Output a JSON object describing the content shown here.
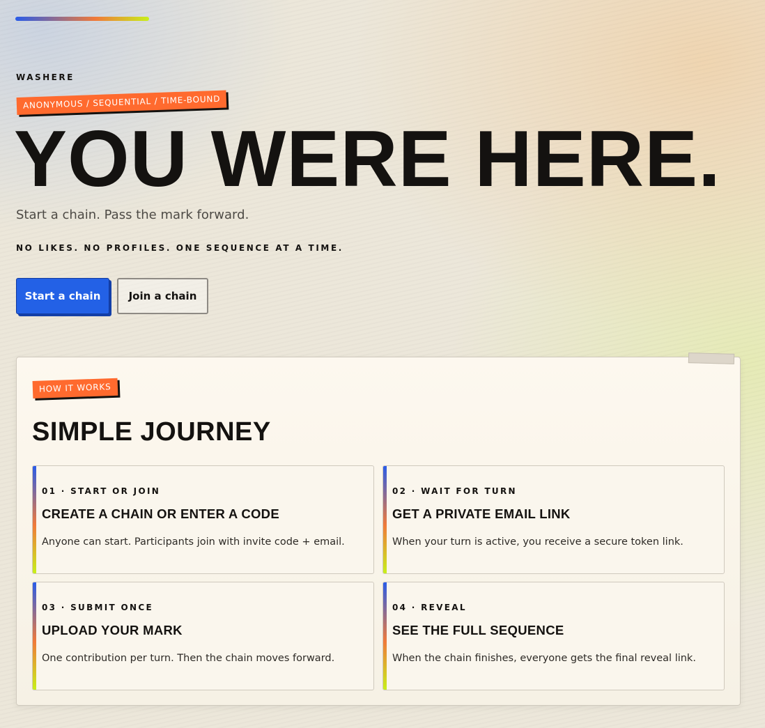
{
  "brand": "WASHERE",
  "hero": {
    "tag": "ANONYMOUS / SEQUENTIAL / TIME-BOUND",
    "title": "YOU WERE HERE.",
    "subtitle": "Start a chain. Pass the mark forward.",
    "note": "NO LIKES. NO PROFILES. ONE SEQUENCE AT A TIME."
  },
  "actions": {
    "start_label": "Start a chain",
    "join_label": "Join a chain"
  },
  "how_it_works": {
    "tag": "HOW IT WORKS",
    "title": "SIMPLE JOURNEY",
    "steps": [
      {
        "step": "01 · START OR JOIN",
        "title": "CREATE A CHAIN OR ENTER A CODE",
        "desc": "Anyone can start. Participants join with invite code + email."
      },
      {
        "step": "02 · WAIT FOR TURN",
        "title": "GET A PRIVATE EMAIL LINK",
        "desc": "When your turn is active, you receive a secure token link."
      },
      {
        "step": "03 · SUBMIT ONCE",
        "title": "UPLOAD YOUR MARK",
        "desc": "One contribution per turn. Then the chain moves forward."
      },
      {
        "step": "04 · REVEAL",
        "title": "SEE THE FULL SEQUENCE",
        "desc": "When the chain finishes, everyone gets the final reveal link."
      }
    ]
  },
  "colors": {
    "accent_orange": "#ff6a2e",
    "primary_blue": "#2361e6",
    "ink": "#141210"
  }
}
